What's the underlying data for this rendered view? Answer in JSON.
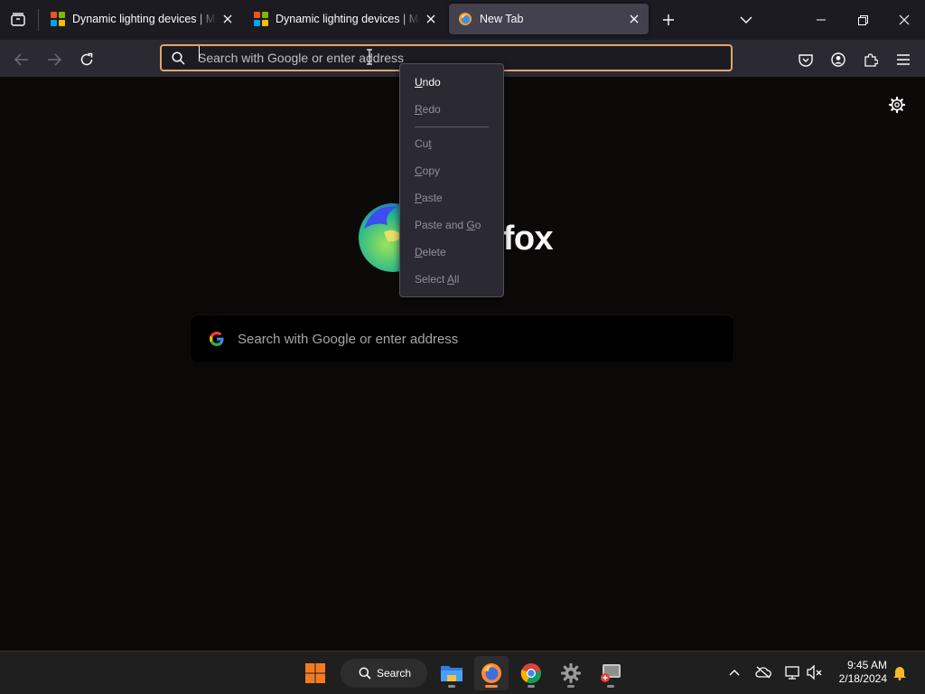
{
  "browser": {
    "tabs": [
      {
        "title": "Dynamic lighting devices | Microsoft Support",
        "favicon": "microsoft-logo-icon",
        "active": false
      },
      {
        "title": "Dynamic lighting devices | Microsoft Support",
        "favicon": "microsoft-logo-icon",
        "active": false
      },
      {
        "title": "New Tab",
        "favicon": "firefox-icon",
        "active": true
      }
    ],
    "urlbar": {
      "placeholder": "Search with Google or enter address",
      "value": ""
    }
  },
  "newtab": {
    "brand_wordmark": "Firefox",
    "search_placeholder": "Search with Google or enter address",
    "search_engine_icon": "google-icon"
  },
  "context_menu": {
    "items": [
      {
        "pre": "",
        "key": "U",
        "post": "ndo",
        "enabled": true
      },
      {
        "pre": "",
        "key": "R",
        "post": "edo",
        "enabled": false
      },
      {
        "pre": "Cu",
        "key": "t",
        "post": "",
        "enabled": false
      },
      {
        "pre": "",
        "key": "C",
        "post": "opy",
        "enabled": false
      },
      {
        "pre": "",
        "key": "P",
        "post": "aste",
        "enabled": false
      },
      {
        "pre": "Paste and ",
        "key": "G",
        "post": "o",
        "enabled": false
      },
      {
        "pre": "",
        "key": "D",
        "post": "elete",
        "enabled": false
      },
      {
        "pre": "Select ",
        "key": "A",
        "post": "ll",
        "enabled": false
      }
    ]
  },
  "taskbar": {
    "search_label": "Search",
    "time": "9:45 AM",
    "date": "2/18/2024"
  },
  "colors": {
    "urlbar_focus": "#e2a56b",
    "taskbar_active_indicator": "#f28c3c"
  }
}
